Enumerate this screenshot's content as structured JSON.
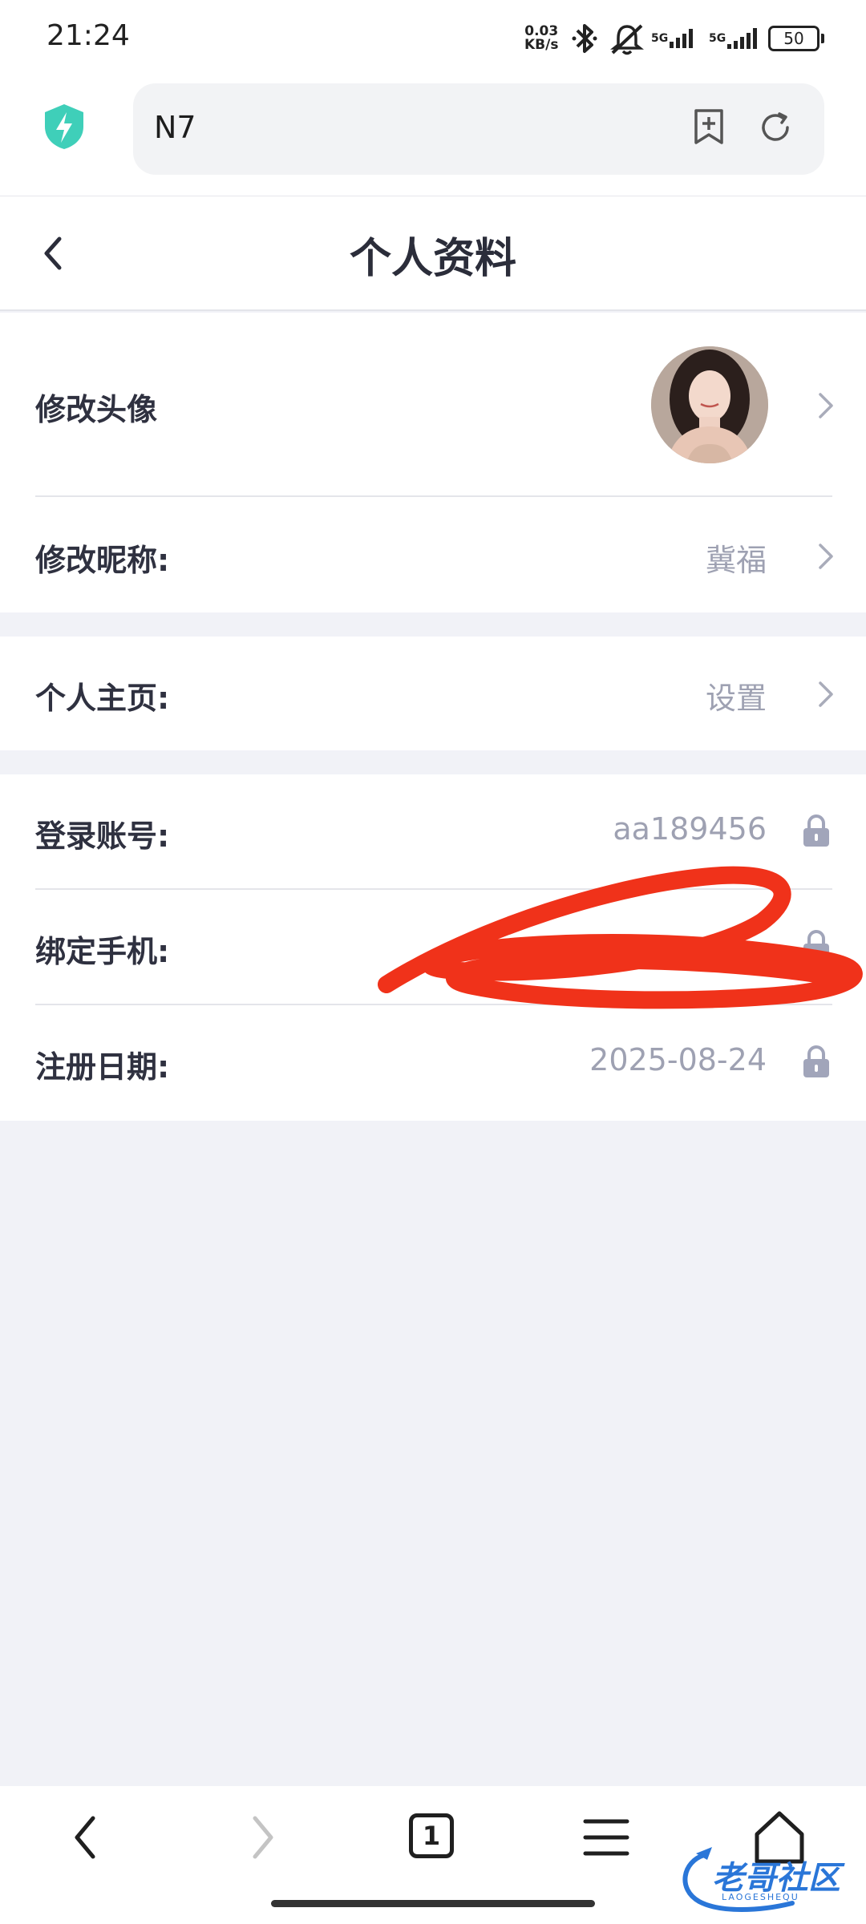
{
  "status_bar": {
    "time": "21:24",
    "net_speed_value": "0.03",
    "net_speed_unit": "KB/s",
    "sim1": "5G",
    "sim2": "5G",
    "battery": "50"
  },
  "browser": {
    "url_text": "N7",
    "icons": [
      "shield-icon",
      "add-bookmark-icon",
      "reload-icon"
    ]
  },
  "header": {
    "title": "个人资料"
  },
  "profile": {
    "avatar_label": "修改头像",
    "nickname_label": "修改昵称:",
    "nickname_value": "冀福",
    "homepage_label": "个人主页:",
    "homepage_value": "设置",
    "account_label": "登录账号:",
    "account_value": "aa189456",
    "phone_label": "绑定手机:",
    "register_label": "注册日期:",
    "register_value": "2025-08-24"
  },
  "bottom_nav": {
    "tab_count": "1",
    "icons": [
      "back-icon",
      "forward-icon",
      "tabs-icon",
      "menu-icon",
      "home-icon"
    ]
  },
  "watermark": {
    "text": "老哥社区",
    "sub": "LAOGESHEQU"
  },
  "colors": {
    "accent_shield": "#3fcfb9",
    "value_gray": "#9ea1b2",
    "scribble_red": "#f0321a",
    "page_bg": "#f1f2f7"
  }
}
